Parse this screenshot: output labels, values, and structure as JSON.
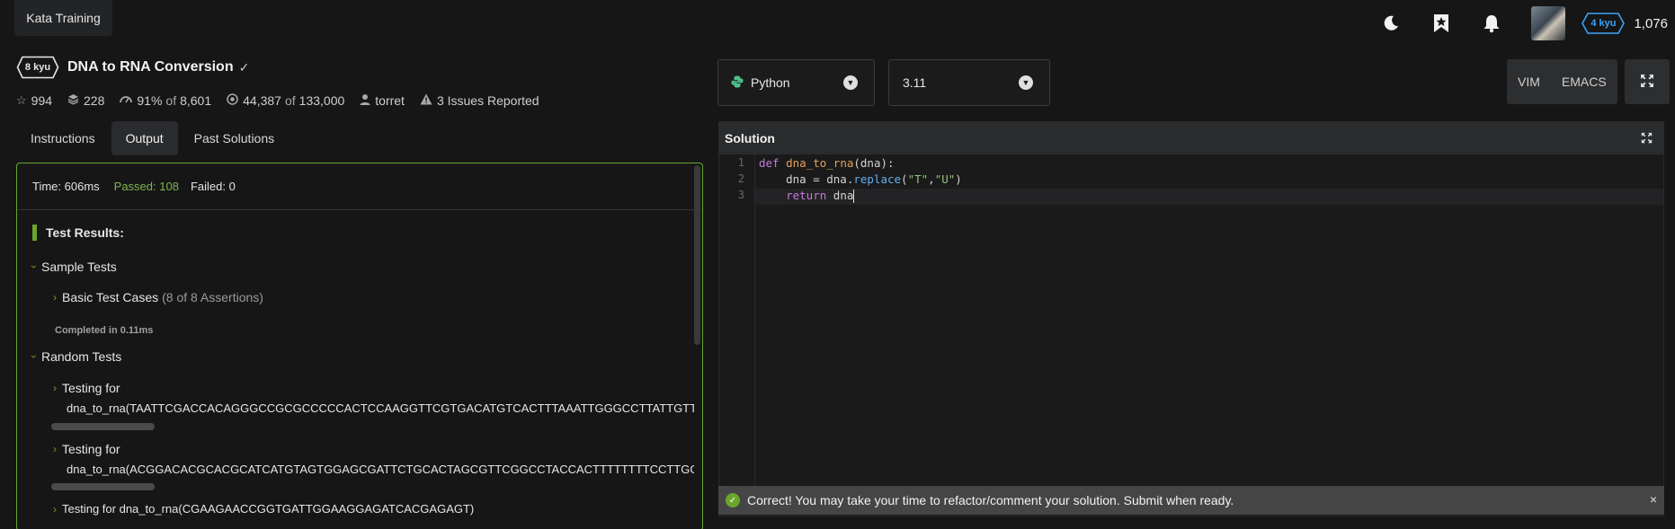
{
  "topbar": {
    "tab_label": "Kata Training",
    "rank_badge": "4 kyu",
    "honor": "1,076",
    "icons": [
      "moon-icon",
      "bookmark-star-icon",
      "bell-icon",
      "avatar"
    ],
    "colors": {
      "rank_blue": "#3ba3f5"
    }
  },
  "kata": {
    "rank": "8 kyu",
    "title": "DNA to RNA Conversion",
    "stats": {
      "stars": "994",
      "collections": "228",
      "satisfaction": "91%",
      "satisfaction_of_label": "of",
      "satisfaction_votes": "8,601",
      "completed": "44,387",
      "completed_of_label": "of",
      "attempts": "133,000",
      "author": "torret",
      "issues": "3 Issues Reported"
    }
  },
  "tabs": [
    {
      "label": "Instructions",
      "active": false
    },
    {
      "label": "Output",
      "active": true
    },
    {
      "label": "Past Solutions",
      "active": false
    }
  ],
  "output": {
    "time": "Time: 606ms",
    "passed": "Passed: 108",
    "failed": "Failed: 0",
    "results_title": "Test Results:",
    "sample_group": "Sample Tests",
    "basic_cases": "Basic Test Cases",
    "basic_assertions": "(8 of 8 Assertions)",
    "completed_in": "Completed in 0.11ms",
    "random_group": "Random Tests",
    "testing_for_label": "Testing for",
    "random_1": "dna_to_rna(TAATTCGACCACAGGGCCGCGCCCCCACTCCAAGGTTCGTGACATGTCACTTTAAATTGGGCCTTATTGTTGCA",
    "random_2": "dna_to_rna(ACGGACACGCACGCATCATGTAGTGGAGCGATTCTGCACTAGCGTTCGGCCTACCACTTTTTTTTCCTTGGCA",
    "random_3": "Testing for dna_to_rna(CGAAGAACCGGTGATTGGAAGGAGATCACGAGAGT)",
    "colors": {
      "pass_green": "#7fb54a",
      "border_green": "#6aa62c"
    }
  },
  "editor_controls": {
    "language": "Python",
    "version": "3.11",
    "modes": [
      "VIM",
      "EMACS"
    ]
  },
  "editor": {
    "title": "Solution",
    "line_numbers": [
      "1",
      "2",
      "3"
    ],
    "code": {
      "l1_kw": "def",
      "l1_fn": "dna_to_rna",
      "l1_rest": "(dna):",
      "l2_a": "    dna = dna.",
      "l2_m": "replace",
      "l2_b": "(",
      "l2_s1": "\"T\"",
      "l2_c": ",",
      "l2_s2": "\"U\"",
      "l2_d": ")",
      "l3_kw": "    return",
      "l3_rest": " dna"
    }
  },
  "toast": {
    "message": "Correct! You may take your time to refactor/comment your solution. Submit when ready.",
    "close": "×"
  }
}
